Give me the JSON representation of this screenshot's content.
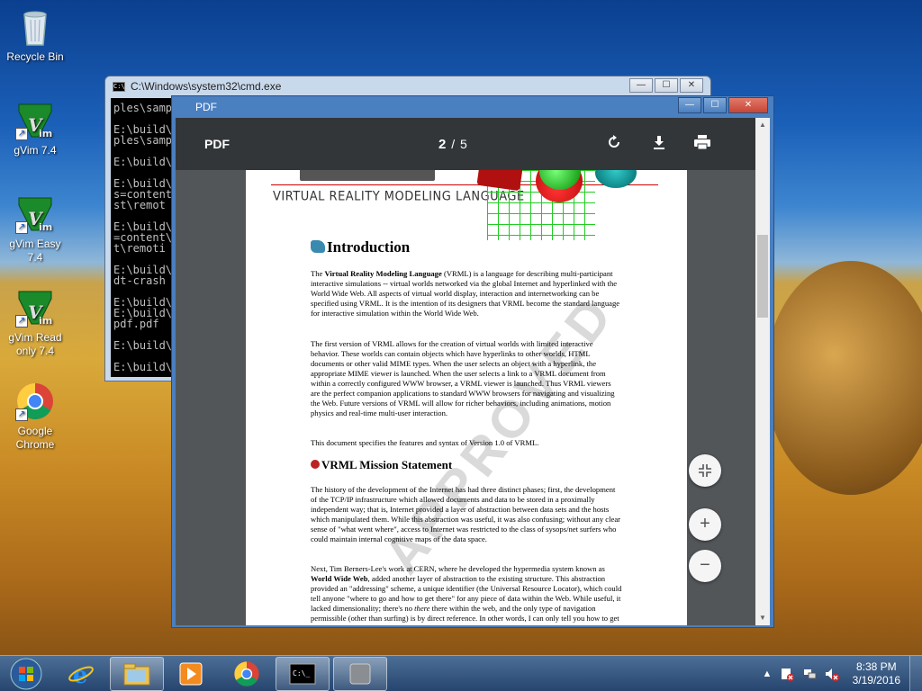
{
  "desktop": {
    "icons": [
      {
        "label": "Recycle Bin"
      },
      {
        "label": "gVim 7.4"
      },
      {
        "label": "gVim Easy 7.4"
      },
      {
        "label": "gVim Read only 7.4"
      },
      {
        "label": "Google Chrome"
      }
    ]
  },
  "cmd": {
    "title": "C:\\Windows\\system32\\cmd.exe",
    "icon_text": "C:\\",
    "lines": [
      "ples\\samp",
      "",
      "E:\\build\\",
      "ples\\samp",
      "",
      "E:\\build\\",
      "",
      "E:\\build\\",
      "s=content",
      "st\\remot",
      "",
      "E:\\build\\",
      "=content\\",
      "t\\remoti",
      "",
      "E:\\build\\",
      "dt-crash",
      "",
      "E:\\build\\",
      "E:\\build\\",
      "pdf.pdf",
      "",
      "E:\\build\\",
      "",
      "E:\\build\\"
    ]
  },
  "pdf_window": {
    "title": "PDF",
    "toolbar": {
      "title": "PDF",
      "current_page": "2",
      "separator": "/",
      "total_pages": "5"
    },
    "icons": {
      "rotate": "rotate-icon",
      "download": "download-icon",
      "print": "print-icon"
    },
    "fab": {
      "fit": "fit-to-page",
      "zoom_in": "+",
      "zoom_out": "−"
    },
    "page": {
      "banner_subtitle": "VIRTUAL REALITY MODELING LANGUAGE",
      "stamp": "APPROVED",
      "h_intro": "Introduction",
      "p1_bold": "Virtual Reality Modeling Language",
      "p1_pre": "The",
      "p1_rest": "(VRML) is a language for describing multi-participant interactive simulations -- virtual worlds networked via the global Internet and hyperlinked with the World Wide Web. All aspects of virtual world display, interaction and internetworking can be specified using VRML. It is the intention of its designers that VRML become the standard language for interactive simulation within the World Wide Web.",
      "p2": "The first version of VRML allows for the creation of virtual worlds with limited interactive behavior. These worlds can contain objects which have hyperlinks to other worlds, HTML documents or other valid MIME types. When the user selects an object with a hyperlink, the appropriate MIME viewer is launched. When the user selects a link to a VRML document from within a correctly configured WWW browser, a VRML viewer is launched. Thus VRML viewers are the perfect companion applications to standard WWW browsers for navigating and visualizing the Web. Future versions of VRML will allow for richer behaviors, including animations, motion physics and real-time multi-user interaction.",
      "p3": "This document specifies the features and syntax of Version 1.0 of VRML.",
      "h_mission": "VRML Mission Statement",
      "p4": "The history of the development of the Internet has had three distinct phases; first, the development of the TCP/IP infrastructure which allowed documents and data to be stored in a proximally independent way; that is, Internet provided a layer of abstraction between data sets and the hosts which manipulated them. While this abstraction was useful, it was also confusing; without any clear sense of \"what went where\", access to Internet was restricted to the class of sysops/net surfers who could maintain internal cognitive maps of the data space.",
      "p5_pre": "Next, Tim Berners-Lee's work at CERN, where he developed the hypermedia system known as",
      "p5_bold": "World Wide Web",
      "p5_mid": ", added another layer of abstraction to the existing structure. This abstraction provided an \"addressing\" scheme, a unique identifier (the Universal Resource Locator), which could tell anyone \"where to go and how to get there\" for any piece of data within the Web. While useful, it lacked dimensionality; there's no",
      "p5_em": "there",
      "p5_end": "there within the web, and the only type of navigation permissible (other than surfing) is by direct reference. In other words, I can only tell you how to get to the VRML Forum"
    }
  },
  "taskbar": {
    "time": "8:38 PM",
    "date": "3/19/2016",
    "tray_icons": [
      "show-hidden-icons",
      "action-center-icon",
      "network-icon",
      "volume-muted-icon"
    ]
  }
}
